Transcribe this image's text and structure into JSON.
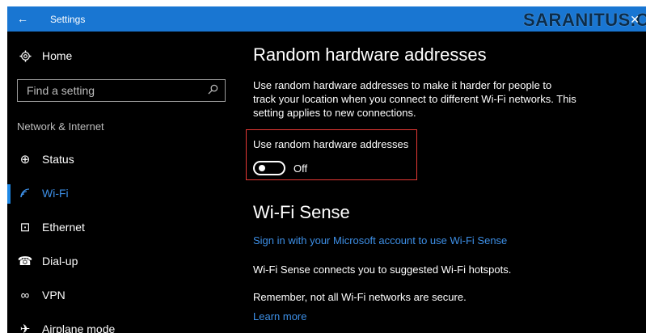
{
  "titlebar": {
    "back_glyph": "←",
    "title": "Settings",
    "watermark": "SARANITUS.COM",
    "close_glyph": "✕"
  },
  "sidebar": {
    "home": {
      "label": "Home",
      "icon": "gear-icon"
    },
    "search": {
      "placeholder": "Find a setting",
      "icon": "search-icon"
    },
    "section_label": "Network & Internet",
    "items": [
      {
        "label": "Status",
        "icon": "globe-icon",
        "glyph": "⊕"
      },
      {
        "label": "Wi-Fi",
        "icon": "wifi-icon",
        "glyph": "◜",
        "selected": true
      },
      {
        "label": "Ethernet",
        "icon": "ethernet-icon",
        "glyph": "⊡"
      },
      {
        "label": "Dial-up",
        "icon": "dialup-icon",
        "glyph": "☎"
      },
      {
        "label": "VPN",
        "icon": "vpn-icon",
        "glyph": "∞"
      },
      {
        "label": "Airplane mode",
        "icon": "airplane-icon",
        "glyph": "✈"
      }
    ]
  },
  "main": {
    "random_hw": {
      "heading": "Random hardware addresses",
      "description": "Use random hardware addresses to make it harder for people to track your location when you connect to different Wi-Fi networks. This setting applies to new connections.",
      "toggle_label": "Use random hardware addresses",
      "toggle_state": "Off"
    },
    "wifi_sense": {
      "heading": "Wi-Fi Sense",
      "sign_in_link": "Sign in with your Microsoft account to use Wi-Fi Sense",
      "description": "Wi-Fi Sense connects you to suggested Wi-Fi hotspots.",
      "warning": "Remember, not all Wi-Fi networks are secure.",
      "learn_more": "Learn more"
    }
  },
  "colors": {
    "accent": "#1976d2",
    "link": "#3d8fe6",
    "highlight_box": "#e53935",
    "background": "#000000"
  }
}
